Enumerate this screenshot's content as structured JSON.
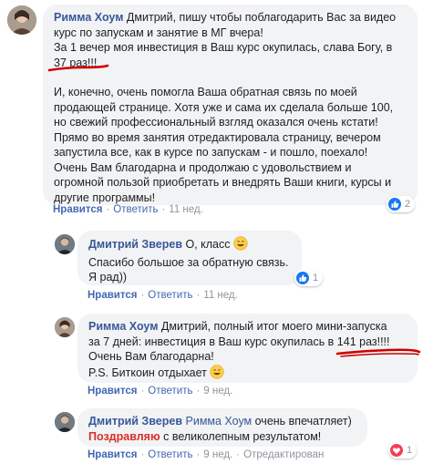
{
  "comments": [
    {
      "author": "Римма Хоум",
      "para1": [
        " Дмитрий, пишу чтобы поблагодарить Вас за видео",
        "курс по запускам и занятие в МГ вчера!",
        "За 1 вечер моя инвестиция в Ваш курс окупилась, слава Богу, в",
        "37 раз!!!"
      ],
      "para2": [
        "И, конечно, очень помогла Ваша обратная связь по моей",
        "продающей странице. Хотя уже и сама их сделала больше 100,",
        "но свежий профессиональный взгляд оказался очень кстати!",
        "Прямо во время занятия отредактировала страницу, вечером",
        "запустила все, как в курсе по запускам - и пошло, поехало!",
        "Очень Вам благодарна и продолжаю с удовольствием и",
        "огромной пользой приобретать и внедрять Ваши книги, курсы и",
        "другие программы!"
      ],
      "like": "Нравится",
      "reply": "Ответить",
      "time": "11 нед.",
      "reaction_count": "2",
      "reaction_type": "like"
    },
    {
      "author": "Дмитрий Зверев",
      "lines": [
        " О, класс",
        "Спасибо большое за обратную связь.",
        "Я рад))"
      ],
      "like": "Нравится",
      "reply": "Ответить",
      "time": "11 нед.",
      "reaction_count": "1",
      "reaction_type": "like"
    },
    {
      "author": "Римма Хоум",
      "lines": [
        " Дмитрий, полный итог моего мини-запуска",
        "за 7 дней: инвестиция в Ваш курс окупилась в 141 раз!!!!",
        "Очень Вам благодарна!",
        "P.S. Биткоин отдыхает"
      ],
      "like": "Нравится",
      "reply": "Ответить",
      "time": "9 нед."
    },
    {
      "author": "Дмитрий Зверев",
      "mention": "Римма Хоум",
      "line1_rest": " очень впечатляет)",
      "hashtag": "Поздравляю",
      "line2_rest": " с великолепным результатом!",
      "like": "Нравится",
      "reply": "Ответить",
      "time": "9 нед.",
      "edited": "Отредактирован",
      "reaction_count": "1",
      "reaction_type": "love"
    }
  ],
  "colors": {
    "bubble": "#f2f3f5",
    "link": "#385898",
    "action": "#4267b2",
    "meta": "#90949c",
    "underline": "#cc0000"
  }
}
